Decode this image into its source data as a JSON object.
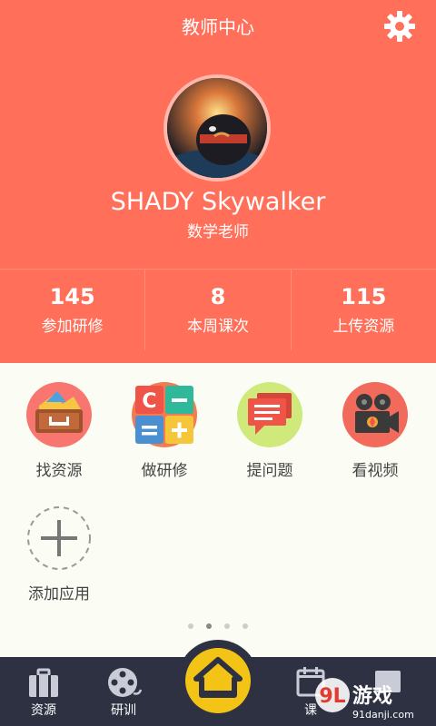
{
  "header": {
    "title": "教师中心",
    "settings_icon": "gear-icon",
    "background_color": "#ff6f5a"
  },
  "profile": {
    "name": "SHADY Skywalker",
    "role": "数学老师"
  },
  "stats": [
    {
      "value": "145",
      "label": "参加研修"
    },
    {
      "value": "8",
      "label": "本周课次"
    },
    {
      "value": "115",
      "label": "上传资源"
    }
  ],
  "apps": [
    {
      "label": "找资源",
      "icon": "resource-box-icon",
      "color": "#f97670"
    },
    {
      "label": "做研修",
      "icon": "calculator-icon",
      "color": "#f27c52"
    },
    {
      "label": "提问题",
      "icon": "chat-bubble-icon",
      "color": "#cfe97a"
    },
    {
      "label": "看视频",
      "icon": "film-camera-icon",
      "color": "#f26a5b"
    },
    {
      "label": "添加应用",
      "icon": "add-icon",
      "color": "#999999"
    }
  ],
  "pager": {
    "count": 4,
    "active": 2
  },
  "tabbar": {
    "tabs": [
      {
        "label": "资源",
        "icon": "briefcase-icon"
      },
      {
        "label": "研训",
        "icon": "film-reel-icon"
      },
      {
        "label": "首页",
        "icon": "home-icon"
      },
      {
        "label": "课",
        "icon": "calendar-icon"
      },
      {
        "label": "",
        "icon": "document-icon"
      }
    ],
    "accent_color": "#f3c316"
  },
  "watermark": {
    "text": "9L游戏",
    "subtext": "91danji.com"
  }
}
